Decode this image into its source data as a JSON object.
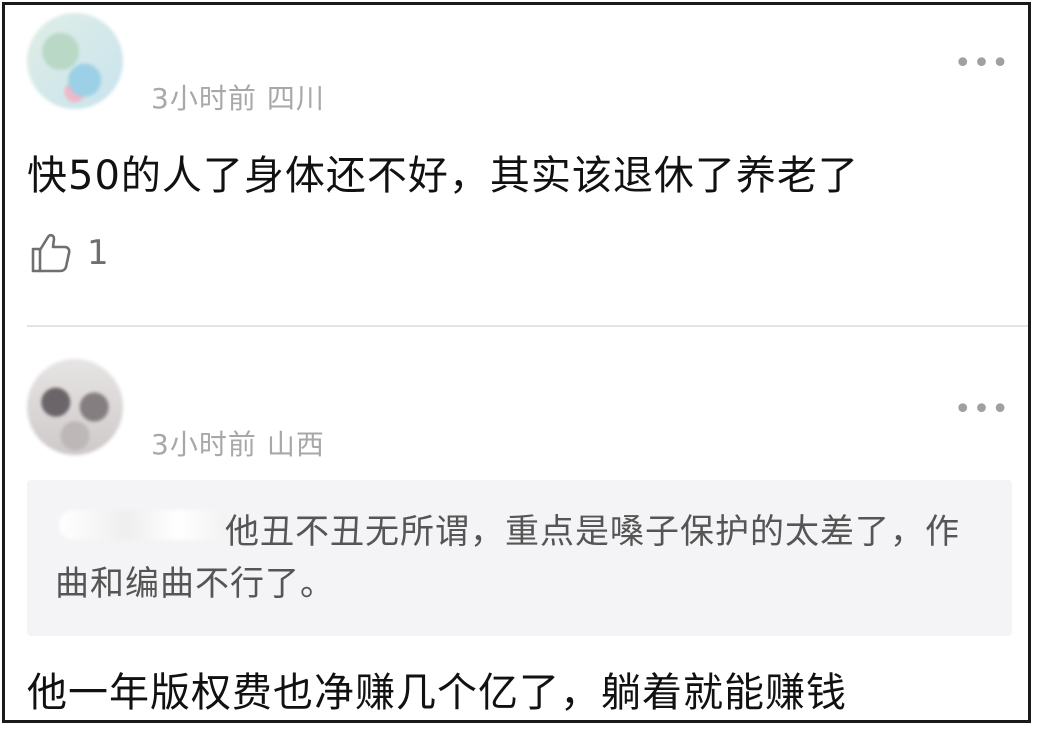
{
  "comments": [
    {
      "time": "3小时前",
      "location": "四川",
      "text": "快50的人了身体还不好，其实该退休了养老了",
      "likes": "1",
      "more_icon": "more-horizontal-icon"
    },
    {
      "time": "3小时前",
      "location": "山西",
      "quote": "他丑不丑无所谓，重点是嗓子保护的太差了，作曲和编曲不行了。",
      "text": "他一年版权费也净赚几个亿了，躺着就能赚钱",
      "more_icon": "more-horizontal-icon"
    }
  ],
  "icons": {
    "like": "thumbs-up-icon",
    "more": "more-horizontal-icon"
  }
}
